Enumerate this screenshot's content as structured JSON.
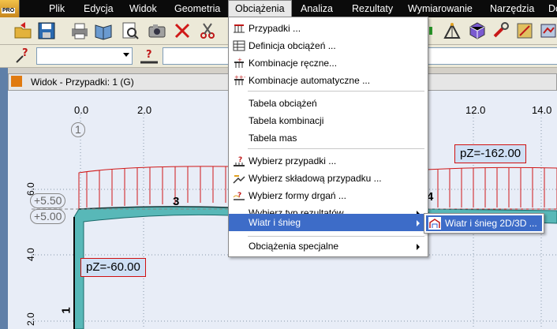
{
  "menubar": {
    "logo_text": "PRO",
    "items": [
      {
        "label": "Plik"
      },
      {
        "label": "Edycja"
      },
      {
        "label": "Widok"
      },
      {
        "label": "Geometria"
      },
      {
        "label": "Obciążenia"
      },
      {
        "label": "Analiza"
      },
      {
        "label": "Rezultaty"
      },
      {
        "label": "Wymiarowanie"
      },
      {
        "label": "Narzędzia"
      },
      {
        "label": "Do"
      }
    ]
  },
  "view": {
    "title": "Widok - Przypadki: 1 (G)",
    "x_ticks": [
      "0.0",
      "2.0",
      "12.0",
      "14.0"
    ],
    "y_ticks": [
      "6.0",
      "4.0",
      "2.0"
    ],
    "node_labels": [
      "1",
      "3",
      "4",
      "1"
    ],
    "level_labels": [
      "+5.50",
      "+5.00"
    ],
    "load_labels": [
      "pZ=-162.00",
      "pZ=-60.00"
    ]
  },
  "dropdown": {
    "items": [
      {
        "label": "Przypadki ...",
        "icon": "load-cases-icon"
      },
      {
        "label": "Definicja obciążeń ...",
        "icon": "load-definition-icon"
      },
      {
        "label": "Kombinacje ręczne...",
        "icon": "manual-combinations-icon"
      },
      {
        "label": "Kombinacje automatyczne ...",
        "icon": "automatic-combinations-icon"
      },
      {
        "label": "Tabela obciążeń"
      },
      {
        "label": "Tabela kombinacji"
      },
      {
        "label": "Tabela mas"
      },
      {
        "label": "Wybierz przypadki ...",
        "icon": "select-cases-icon"
      },
      {
        "label": "Wybierz składową przypadku ...",
        "icon": "select-component-icon"
      },
      {
        "label": "Wybierz formy drgań ...",
        "icon": "select-modes-icon"
      },
      {
        "label": "Wybierz typ rezultatów"
      },
      {
        "label": "Wiatr i śnieg"
      },
      {
        "label": "Obciążenia specjalne"
      }
    ]
  },
  "submenu": {
    "label": "Wiatr i śnieg 2D/3D ...",
    "icon": "wind-snow-icon"
  }
}
